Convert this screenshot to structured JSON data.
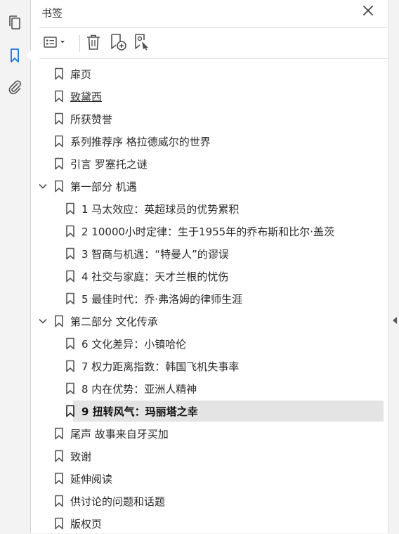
{
  "panel": {
    "title": "书签"
  },
  "sidebar": {
    "items": [
      {
        "name": "pages-icon"
      },
      {
        "name": "bookmark-icon",
        "active": true
      },
      {
        "name": "attachment-icon"
      }
    ]
  },
  "toolbar": {
    "options_icon": "list-options-icon",
    "delete_icon": "trash-icon",
    "new_bookmark_icon": "new-bookmark-icon",
    "bookmark_from_structure_icon": "bookmark-tag-icon"
  },
  "bookmarks": [
    {
      "label": "扉页",
      "level": 0
    },
    {
      "label": "致黛西",
      "level": 0,
      "underline": true
    },
    {
      "label": "所获赞誉",
      "level": 0
    },
    {
      "label": "系列推荐序 格拉德威尔的世界",
      "level": 0
    },
    {
      "label": "引言 罗塞托之谜",
      "level": 0
    },
    {
      "label": "第一部分 机遇",
      "level": 0,
      "expanded": true
    },
    {
      "label": "1 马太效应：英超球员的优势累积",
      "level": 1
    },
    {
      "label": "2 10000小时定律：生于1955年的乔布斯和比尔·盖茨",
      "level": 1
    },
    {
      "label": "3 智商与机遇：“特曼人”的谬误",
      "level": 1
    },
    {
      "label": "4 社交与家庭：天才兰根的忧伤",
      "level": 1
    },
    {
      "label": "5 最佳时代：乔·弗洛姆的律师生涯",
      "level": 1
    },
    {
      "label": "第二部分 文化传承",
      "level": 0,
      "expanded": true
    },
    {
      "label": "6 文化差异：小镇哈伦",
      "level": 1
    },
    {
      "label": "7 权力距离指数：韩国飞机失事率",
      "level": 1
    },
    {
      "label": "8 内在优势：亚洲人精神",
      "level": 1
    },
    {
      "label": "9 扭转风气：玛丽塔之幸",
      "level": 1,
      "selected": true
    },
    {
      "label": "尾声 故事来自牙买加",
      "level": 0
    },
    {
      "label": "致谢",
      "level": 0
    },
    {
      "label": "延伸阅读",
      "level": 0
    },
    {
      "label": "供讨论的问题和话题",
      "level": 0
    },
    {
      "label": "版权页",
      "level": 0
    }
  ],
  "colors": {
    "accent": "#1473e6",
    "icon": "#505050",
    "selected_bg": "#e4e4e4"
  }
}
